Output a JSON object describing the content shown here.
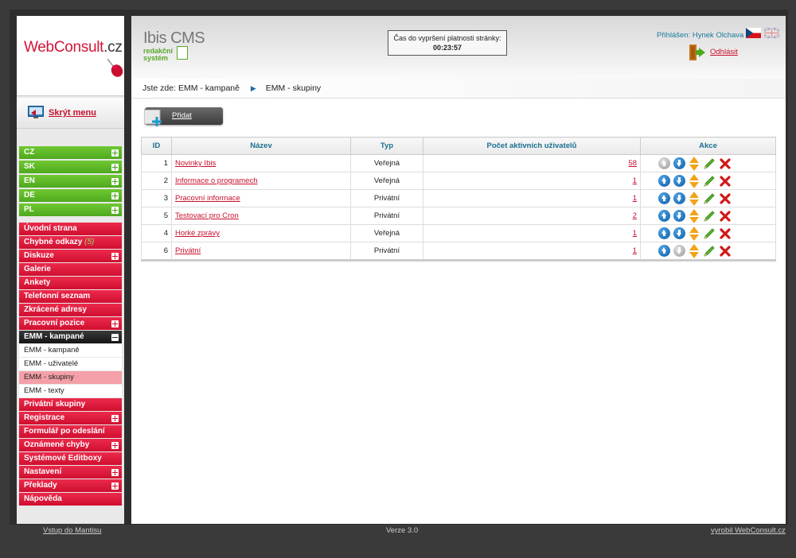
{
  "logo": {
    "brand": "WebConsult",
    "suffix": ".cz"
  },
  "sidebar": {
    "hide_menu": "Skrýt menu",
    "languages": [
      {
        "label": "CZ"
      },
      {
        "label": "SK"
      },
      {
        "label": "EN"
      },
      {
        "label": "DE"
      },
      {
        "label": "PL"
      }
    ],
    "items": [
      {
        "label": "Úvodní strana",
        "expand": false
      },
      {
        "label": "Chybné odkazy",
        "count": "(5)",
        "expand": false
      },
      {
        "label": "Diskuze",
        "expand": true
      },
      {
        "label": "Galerie",
        "expand": false
      },
      {
        "label": "Ankety",
        "expand": false
      },
      {
        "label": "Telefonní seznam",
        "expand": false
      },
      {
        "label": "Zkrácené adresy",
        "expand": false
      },
      {
        "label": "Pracovní pozice",
        "expand": true
      },
      {
        "label": "EMM - kampané",
        "open": true
      },
      {
        "label": "Privátní skupiny",
        "expand": false
      },
      {
        "label": "Registrace",
        "expand": true
      },
      {
        "label": "Formulář po odeslání",
        "expand": false
      },
      {
        "label": "Oznámené chyby",
        "expand": true
      },
      {
        "label": "Systémové Editboxy",
        "expand": false
      },
      {
        "label": "Nastavení",
        "expand": true
      },
      {
        "label": "Překlady",
        "expand": true
      },
      {
        "label": "Nápověda",
        "expand": false
      }
    ],
    "emm_sub": [
      "EMM - kampaně",
      "EMM - uživatelé",
      "EMM - skupiny",
      "EMM - texty"
    ],
    "emm_active": "EMM - skupiny"
  },
  "header": {
    "cms_title": "Ibis CMS",
    "cms_sub1": "redakční",
    "cms_sub2": "systém",
    "timer_label": "Čas do vypršení platnosti stránky:",
    "timer_value": "00:23:57",
    "logged_in": "Přihlášen: Hynek Olchava",
    "logout": "Odhlásit"
  },
  "breadcrumb": {
    "prefix": "Jste zde:",
    "items": [
      "EMM - kampaně",
      "EMM - skupiny"
    ]
  },
  "toolbar": {
    "add_label": "Přidat"
  },
  "table": {
    "headers": [
      "ID",
      "Název",
      "Typ",
      "Počet aktivních uživatelů",
      "Akce"
    ],
    "rows": [
      {
        "id": "1",
        "name": "Novinky Ibis",
        "type": "Veřejná",
        "count": "58",
        "up_disabled": true,
        "down_disabled": false
      },
      {
        "id": "2",
        "name": "Informace o programech",
        "type": "Veřejná",
        "count": "1",
        "up_disabled": false,
        "down_disabled": false
      },
      {
        "id": "3",
        "name": "Pracovní informace",
        "type": "Privátní",
        "count": "1",
        "up_disabled": false,
        "down_disabled": false
      },
      {
        "id": "5",
        "name": "Testovací pro Cron",
        "type": "Privátní",
        "count": "2",
        "up_disabled": false,
        "down_disabled": false
      },
      {
        "id": "4",
        "name": "Horké zprávy",
        "type": "Veřejná",
        "count": "1",
        "up_disabled": false,
        "down_disabled": false
      },
      {
        "id": "6",
        "name": "Privátní",
        "type": "Privátní",
        "count": "1",
        "up_disabled": false,
        "down_disabled": true
      }
    ]
  },
  "footer": {
    "left": "Vstup do Mantisu",
    "center": "Verze 3.0",
    "right": "vyrobil WebConsult.cz"
  },
  "colors": {
    "accent_red": "#d4143a",
    "accent_green": "#4ea91d",
    "header_blue": "#1a6f8f"
  }
}
